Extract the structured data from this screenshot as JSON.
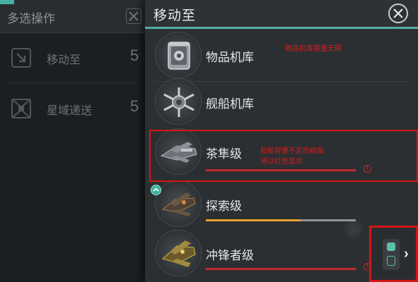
{
  "left_panel": {
    "title": "多选操作",
    "items": [
      {
        "label": "移动至",
        "count": "5",
        "icon": "move-to-icon"
      },
      {
        "label": "星域递送",
        "count": "5",
        "icon": "sector-delivery-icon"
      }
    ]
  },
  "right_panel": {
    "title": "移动至",
    "rows": [
      {
        "label": "物品机库",
        "icon": "item-hangar-icon"
      },
      {
        "label": "舰船机库",
        "icon": "ship-hangar-icon"
      },
      {
        "label": "茶隼级",
        "icon": "kestrel-ship-icon",
        "capacity_fill": 1.0,
        "bar_color": "#c0292a",
        "warning": true
      },
      {
        "label": "探索级",
        "icon": "explorer-ship-icon",
        "capacity_fill": 0.63,
        "bar_color": "#e9a233",
        "warning": false
      },
      {
        "label": "冲锋者级",
        "icon": "charger-ship-icon",
        "capacity_fill": 1.0,
        "bar_color": "#c0292a",
        "warning": true
      }
    ]
  },
  "annotations": {
    "item_hangar_note": "物品机库容量无限",
    "capacity_note_line1": "船舱容量不足的舰船",
    "capacity_note_line2": "将以红色显示"
  },
  "colors": {
    "accent": "#4fb0a0",
    "warning_red": "#c0292a",
    "annotation_red": "#d61414",
    "partial_fill": "#e9a233"
  }
}
